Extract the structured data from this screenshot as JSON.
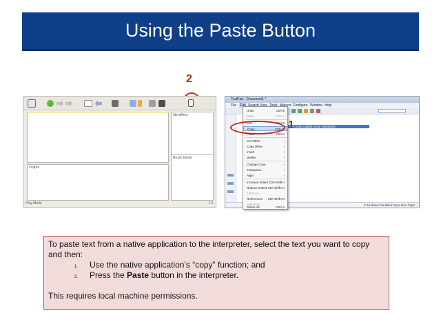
{
  "title": "Using the Paste Button",
  "callouts": {
    "paste_button": "2",
    "copy_item": "1"
  },
  "colors": {
    "banner": "#0f3f86",
    "callout": "#d4201a",
    "info_bg": "#f2dcdb",
    "info_border": "#c0504d"
  },
  "interpreter": {
    "pane_top_right": "Identifiers",
    "pane_bottom_left": "Output",
    "pane_bottom_right": "Brush Detail",
    "status_left": "Play Mode",
    "status_right": "1:1",
    "toolbar_icons": [
      "list-icon",
      "play-icon",
      "forward-icon",
      "forward-icon",
      "text-icon",
      "undo-icon",
      "image-icon",
      "copy-icon",
      "pencil-icon",
      "stop-icon",
      "save-icon",
      "paste-icon"
    ]
  },
  "textpad": {
    "title": "TextPad - Document1 *",
    "menus": [
      "File",
      "Edit",
      "Search",
      "View",
      "Tools",
      "Macros",
      "Configure",
      "Window",
      "Help"
    ],
    "selected_text": "text to be copied to the interpreter",
    "status": "2   34   Read   Ovr   Block   Sync   Rec   Caps",
    "edit_menu": [
      {
        "label": "Undo",
        "shortcut": "Ctrl+Z",
        "disabled": false,
        "highlight": false
      },
      {
        "label": "Redo",
        "shortcut": "Ctrl+Y",
        "disabled": true,
        "highlight": false
      },
      {
        "label": "Cut",
        "shortcut": "Ctrl+X",
        "disabled": false,
        "highlight": false
      },
      {
        "label": "Copy",
        "shortcut": "Ctrl+C",
        "disabled": false,
        "highlight": true
      },
      {
        "label": "Paste",
        "shortcut": "Ctrl+V",
        "disabled": false,
        "highlight": false
      },
      {
        "label": "Cut Other",
        "shortcut": "",
        "disabled": false,
        "highlight": false
      },
      {
        "label": "Copy Other",
        "shortcut": "",
        "disabled": false,
        "highlight": false
      },
      {
        "label": "Insert",
        "shortcut": "",
        "disabled": false,
        "highlight": false
      },
      {
        "label": "Delete",
        "shortcut": "",
        "disabled": false,
        "highlight": false
      },
      {
        "label": "Change Case",
        "shortcut": "",
        "disabled": false,
        "highlight": false
      },
      {
        "label": "Transpose",
        "shortcut": "",
        "disabled": false,
        "highlight": false
      },
      {
        "label": "Align",
        "shortcut": "",
        "disabled": false,
        "highlight": false
      },
      {
        "label": "Increase Indent",
        "shortcut": "Ctrl+Shift+I",
        "disabled": false,
        "highlight": false
      },
      {
        "label": "Reduce Indent",
        "shortcut": "Ctrl+Shift+U",
        "disabled": false,
        "highlight": false
      },
      {
        "label": "Fill Block",
        "shortcut": "",
        "disabled": true,
        "highlight": false
      },
      {
        "label": "References",
        "shortcut": "Ctrl+Shift+R",
        "disabled": false,
        "highlight": false
      },
      {
        "label": "Multi-Edit",
        "shortcut": "",
        "disabled": true,
        "highlight": false
      },
      {
        "label": "Select All",
        "shortcut": "Ctrl+A",
        "disabled": false,
        "highlight": false
      }
    ]
  },
  "info": {
    "intro": "To paste text from a native application to the interpreter, select the text you want to copy and then:",
    "steps": [
      {
        "num": "1.",
        "text": "Use the native application’s “copy” function; and"
      },
      {
        "num": "2.",
        "prefix": "Press the ",
        "bold": "Paste",
        "suffix": " button in the interpreter."
      }
    ],
    "note": "This requires  local machine permissions."
  }
}
